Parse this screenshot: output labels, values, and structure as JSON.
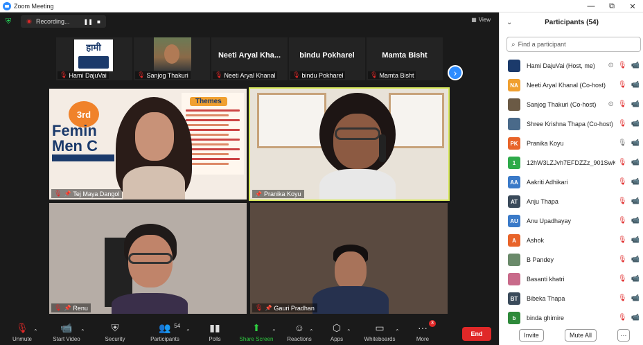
{
  "window": {
    "title": "Zoom Meeting",
    "controls": [
      "—",
      "⧉",
      "✕"
    ]
  },
  "topbar": {
    "recording_label": "Recording...",
    "view_label": "View"
  },
  "thumbnails": [
    {
      "label": "Hami DajuVai",
      "logo_text": "हामी"
    },
    {
      "label": "Sanjog Thakuri"
    },
    {
      "display": "Neeti Aryal Kha...",
      "label": "Neeti Aryal Khanal"
    },
    {
      "display": "bindu Pokharel",
      "label": "bindu Pokharel"
    },
    {
      "display": "Mamta Bisht",
      "label": "Mamta Bisht"
    }
  ],
  "tiles": [
    {
      "label": "Tej Maya Dangol",
      "banner_ordinal": "3rd",
      "banner_text_1": "Femin",
      "banner_text_2": "Men C",
      "banner_side": "Themes"
    },
    {
      "label": "Pranika Koyu"
    },
    {
      "label": "Renu"
    },
    {
      "label": "Gauri Pradhan"
    }
  ],
  "toolbar": {
    "unmute": "Unmute",
    "start_video": "Start Video",
    "security": "Security",
    "participants": "Participants",
    "participants_count": "54",
    "polls": "Polls",
    "share_screen": "Share Screen",
    "reactions": "Reactions",
    "apps": "Apps",
    "whiteboards": "Whiteboards",
    "more": "More",
    "more_badge": "3",
    "end": "End"
  },
  "panel": {
    "title": "Participants (54)",
    "search_placeholder": "Find a participant",
    "participants": [
      {
        "initials": "",
        "name": "Hami DajuVai (Host, me)",
        "avatar_color": "#1b3a6b",
        "rec": true,
        "mic": "muted",
        "video": "off"
      },
      {
        "initials": "NA",
        "name": "Neeti Aryal Khanal (Co-host)",
        "avatar_color": "#f0a030",
        "rec": false,
        "mic": "muted",
        "video": "off"
      },
      {
        "initials": "",
        "name": "Sanjog Thakuri (Co-host)",
        "avatar_color": "#6b5a45",
        "rec": true,
        "mic": "muted",
        "video": "off"
      },
      {
        "initials": "",
        "name": "Shree Krishna Thapa (Co-host)",
        "avatar_color": "#4a6a8a",
        "rec": false,
        "mic": "muted",
        "video": "off"
      },
      {
        "initials": "PK",
        "name": "Pranika Koyu",
        "avatar_color": "#e8642a",
        "rec": false,
        "mic": "on",
        "video": "on"
      },
      {
        "initials": "1",
        "name": "12hW3LZJvh7EFDZZz_901SwKg...",
        "avatar_color": "#2eaa4a",
        "rec": false,
        "mic": "muted",
        "video": "off"
      },
      {
        "initials": "AA",
        "name": "Aakriti Adhikari",
        "avatar_color": "#3a7ac8",
        "rec": false,
        "mic": "muted",
        "video": "off"
      },
      {
        "initials": "AT",
        "name": "Anju Thapa",
        "avatar_color": "#3a4a5a",
        "rec": false,
        "mic": "muted",
        "video": "off"
      },
      {
        "initials": "AU",
        "name": "Anu Upadhayay",
        "avatar_color": "#3a7ac8",
        "rec": false,
        "mic": "muted",
        "video": "off"
      },
      {
        "initials": "A",
        "name": "Ashok",
        "avatar_color": "#e8642a",
        "rec": false,
        "mic": "muted",
        "video": "off"
      },
      {
        "initials": "",
        "name": "B Pandey",
        "avatar_color": "#6a8a6a",
        "rec": false,
        "mic": "muted",
        "video": "off"
      },
      {
        "initials": "",
        "name": "Basanti khatri",
        "avatar_color": "#c86a8a",
        "rec": false,
        "mic": "muted",
        "video": "off"
      },
      {
        "initials": "BT",
        "name": "Bibeka Thapa",
        "avatar_color": "#3a4a5a",
        "rec": false,
        "mic": "muted",
        "video": "off"
      },
      {
        "initials": "b",
        "name": "binda ghimire",
        "avatar_color": "#2e8a3a",
        "rec": false,
        "mic": "muted",
        "video": "off"
      }
    ],
    "invite": "Invite",
    "mute_all": "Mute All",
    "more": "···"
  }
}
